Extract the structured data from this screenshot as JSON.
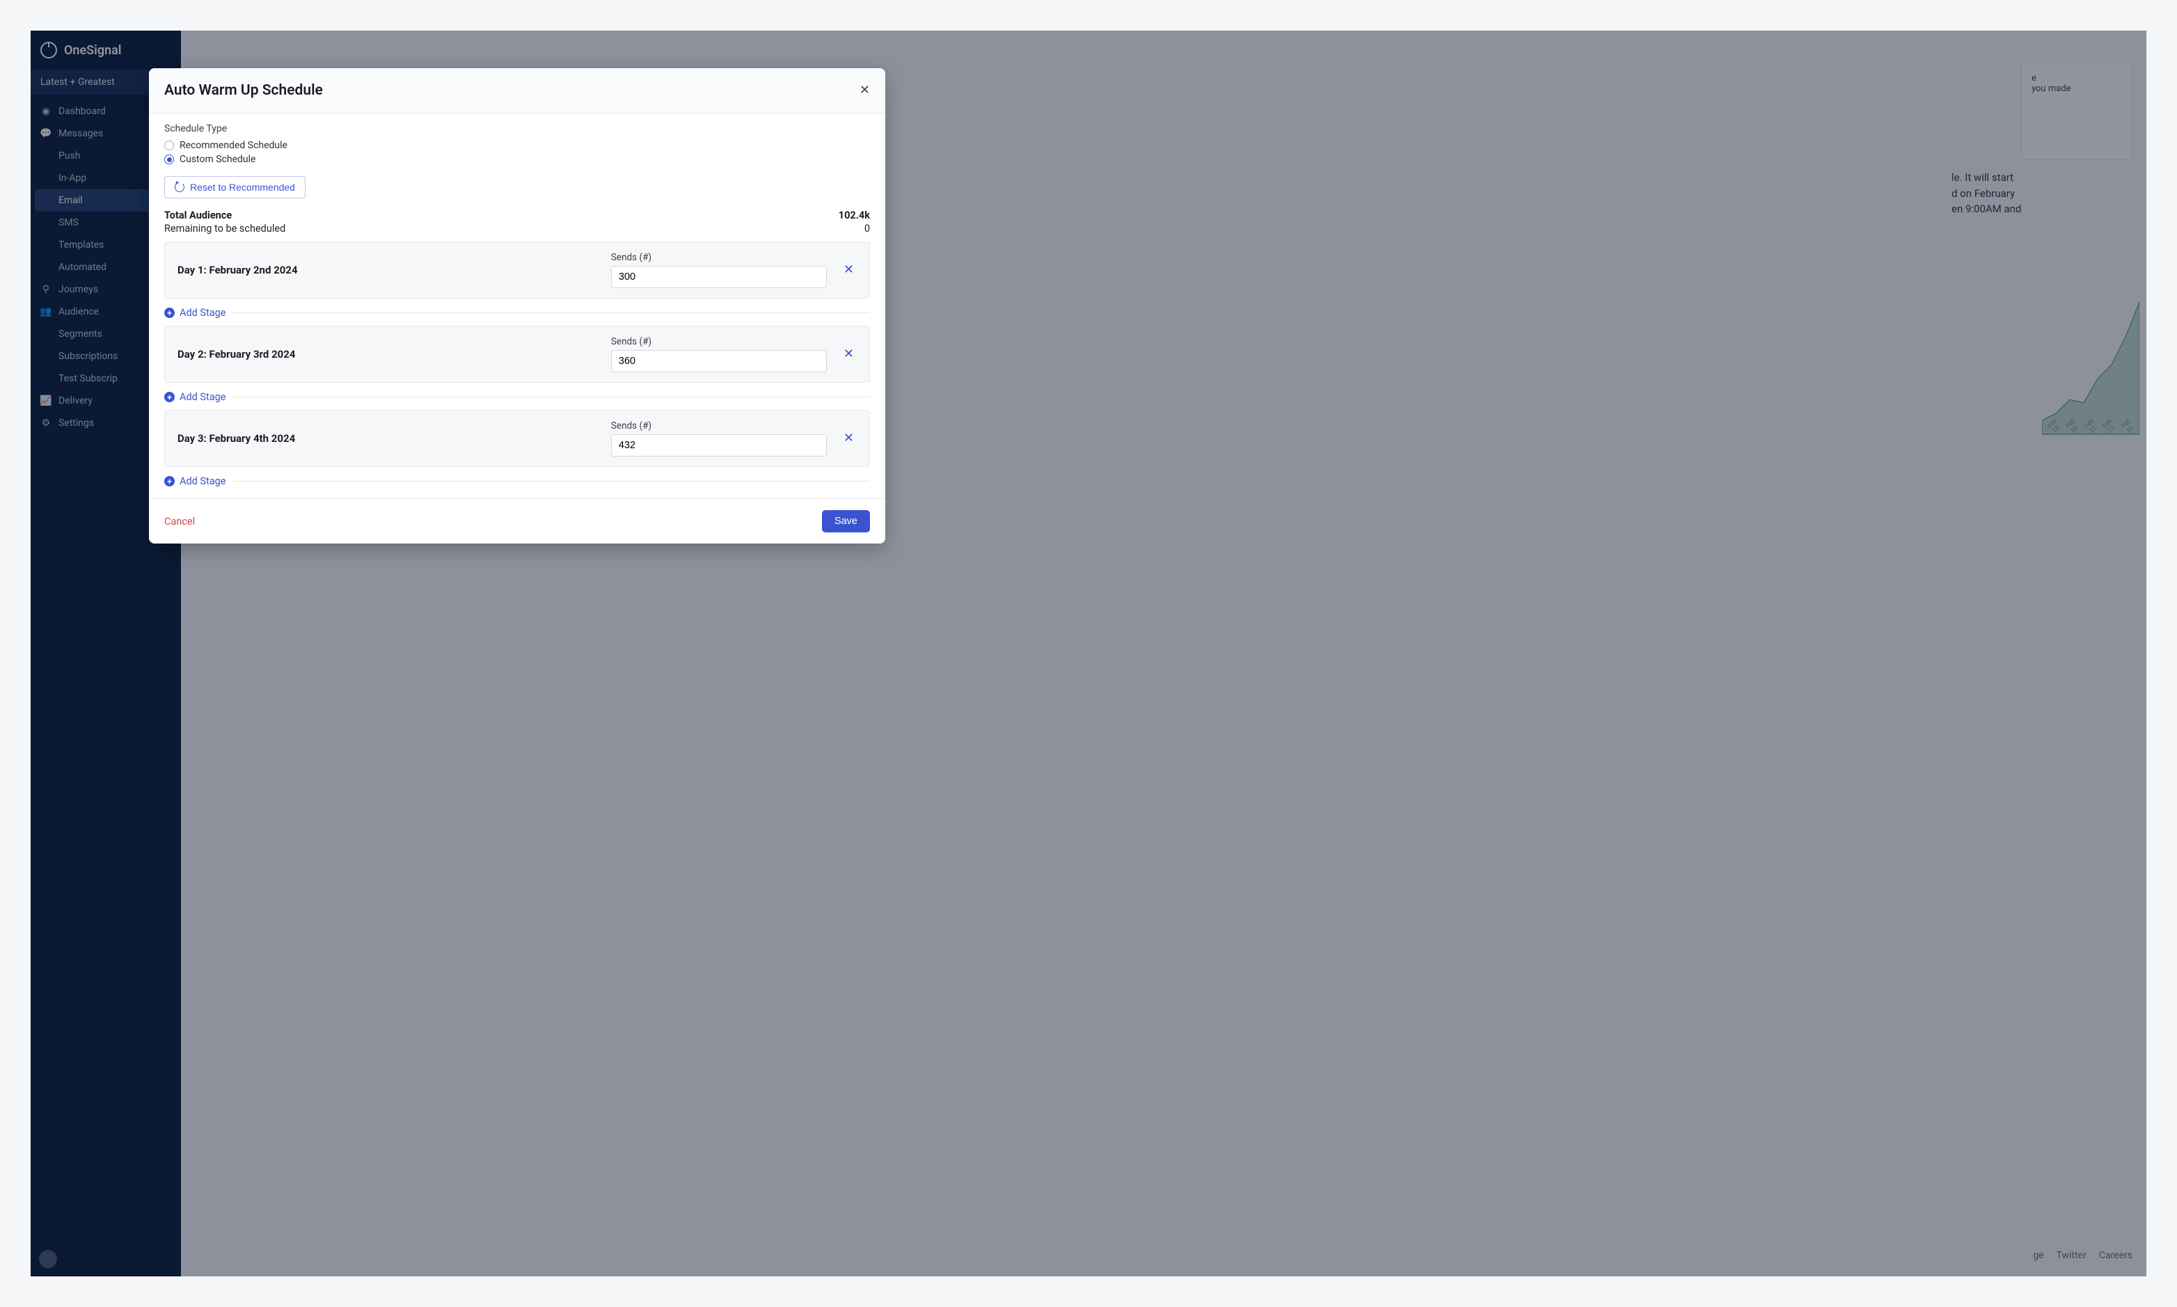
{
  "brand": "OneSignal",
  "app_selector": "Latest + Greatest",
  "sidebar": {
    "items": [
      {
        "label": "Dashboard",
        "icon": "dashboard-icon"
      },
      {
        "label": "Messages",
        "icon": "messages-icon",
        "children": [
          {
            "label": "Push"
          },
          {
            "label": "In-App"
          },
          {
            "label": "Email",
            "active": true
          },
          {
            "label": "SMS"
          },
          {
            "label": "Templates"
          },
          {
            "label": "Automated"
          }
        ]
      },
      {
        "label": "Journeys",
        "icon": "journeys-icon"
      },
      {
        "label": "Audience",
        "icon": "audience-icon",
        "children": [
          {
            "label": "Segments"
          },
          {
            "label": "Subscriptions"
          },
          {
            "label": "Test Subscrip"
          }
        ]
      },
      {
        "label": "Delivery",
        "icon": "delivery-icon"
      },
      {
        "label": "Settings",
        "icon": "settings-icon"
      }
    ]
  },
  "background": {
    "card_text": "e\nyou made",
    "paragraph": "le. It will start\nd on February\nen 9:00AM and",
    "chart_ticks": [
      "Feb 19",
      "Feb 20",
      "Feb 21",
      "Feb 22",
      "Feb 23"
    ],
    "footer_links": [
      "ge",
      "Twitter",
      "Careers"
    ]
  },
  "modal": {
    "title": "Auto Warm Up Schedule",
    "schedule_type_label": "Schedule Type",
    "radio_recommended": "Recommended Schedule",
    "radio_custom": "Custom Schedule",
    "reset_label": "Reset to Recommended",
    "total_audience_label": "Total Audience",
    "total_audience_value": "102.4k",
    "remaining_label": "Remaining to be scheduled",
    "remaining_value": "0",
    "sends_label": "Sends (#)",
    "add_stage_label": "Add Stage",
    "stages": [
      {
        "day_label": "Day 1: February 2nd 2024",
        "sends": "300"
      },
      {
        "day_label": "Day 2: February 3rd 2024",
        "sends": "360"
      },
      {
        "day_label": "Day 3: February 4th 2024",
        "sends": "432"
      }
    ],
    "cancel_label": "Cancel",
    "save_label": "Save"
  }
}
